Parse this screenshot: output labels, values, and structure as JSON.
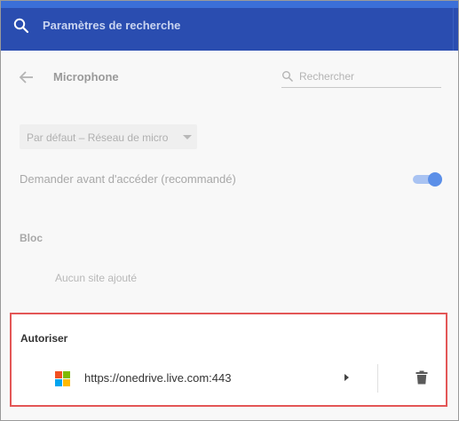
{
  "header": {
    "title": "Paramètres de recherche",
    "icon": "search-icon",
    "colors": {
      "bar": "#2a4db0",
      "strip": "#3b6fd8"
    }
  },
  "page": {
    "title": "Microphone",
    "back_icon": "arrow-left-icon",
    "search": {
      "placeholder": "Rechercher",
      "value": ""
    }
  },
  "device": {
    "selected": "Par défaut – Réseau de micro"
  },
  "ask_before": {
    "label": "Demander avant d'accéder (recommandé)",
    "enabled": true
  },
  "block": {
    "heading": "Bloc",
    "empty_text": "Aucun site ajouté"
  },
  "allow": {
    "heading": "Autoriser",
    "sites": [
      {
        "url": "https://onedrive.live.com:443",
        "icon": "microsoft-logo-icon"
      }
    ],
    "highlight_color": "#e35656"
  }
}
